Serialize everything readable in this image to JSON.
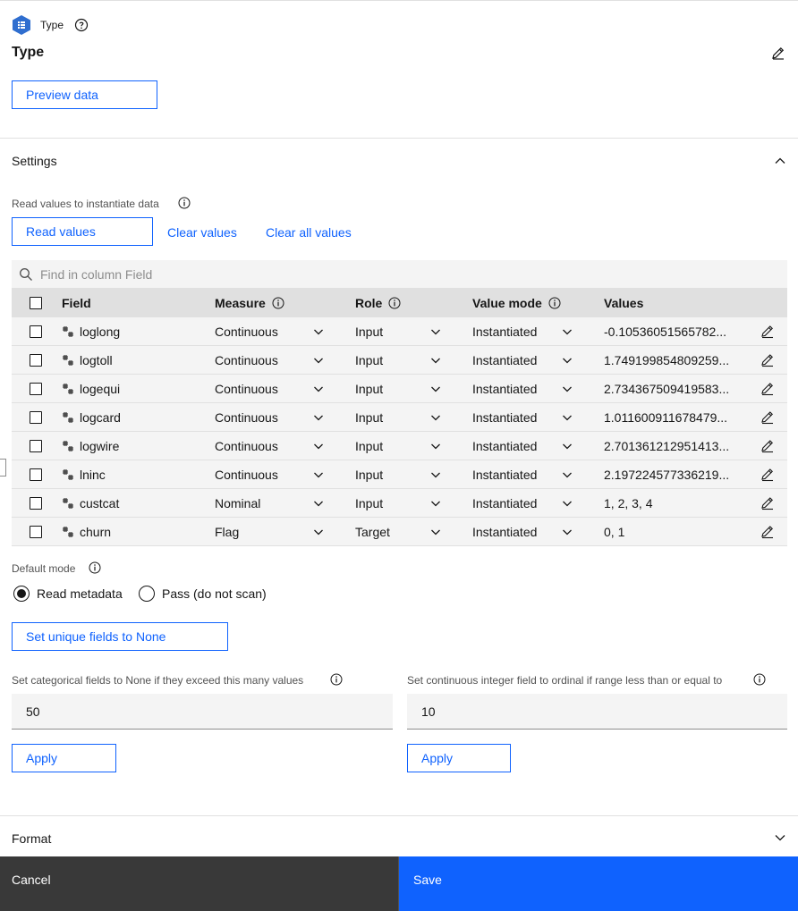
{
  "header": {
    "node_type_label": "Type",
    "title": "Type",
    "preview_button": "Preview data"
  },
  "settings": {
    "section_title": "Settings",
    "read_values_label": "Read values to instantiate data",
    "read_values_button": "Read values",
    "clear_values_link": "Clear values",
    "clear_all_values_link": "Clear all values",
    "search_placeholder": "Find in column Field",
    "columns": {
      "field": "Field",
      "measure": "Measure",
      "role": "Role",
      "value_mode": "Value mode",
      "values": "Values"
    },
    "rows": [
      {
        "field": "loglong",
        "measure": "Continuous",
        "role": "Input",
        "value_mode": "Instantiated",
        "values": "-0.10536051565782..."
      },
      {
        "field": "logtoll",
        "measure": "Continuous",
        "role": "Input",
        "value_mode": "Instantiated",
        "values": "1.749199854809259..."
      },
      {
        "field": "logequi",
        "measure": "Continuous",
        "role": "Input",
        "value_mode": "Instantiated",
        "values": "2.734367509419583..."
      },
      {
        "field": "logcard",
        "measure": "Continuous",
        "role": "Input",
        "value_mode": "Instantiated",
        "values": "1.011600911678479..."
      },
      {
        "field": "logwire",
        "measure": "Continuous",
        "role": "Input",
        "value_mode": "Instantiated",
        "values": "2.701361212951413..."
      },
      {
        "field": "lninc",
        "measure": "Continuous",
        "role": "Input",
        "value_mode": "Instantiated",
        "values": "2.197224577336219..."
      },
      {
        "field": "custcat",
        "measure": "Nominal",
        "role": "Input",
        "value_mode": "Instantiated",
        "values": "1, 2, 3, 4"
      },
      {
        "field": "churn",
        "measure": "Flag",
        "role": "Target",
        "value_mode": "Instantiated",
        "values": "0, 1"
      }
    ],
    "default_mode_label": "Default mode",
    "default_mode_options": [
      "Read metadata",
      "Pass (do not scan)"
    ],
    "default_mode_selected": "Read metadata",
    "unique_fields_button": "Set unique fields to None",
    "categorical_label": "Set categorical fields to None if they exceed this many values",
    "categorical_value": "50",
    "ordinal_label": "Set continuous integer field to ordinal if range less than or equal to",
    "ordinal_value": "10",
    "apply_label": "Apply"
  },
  "format": {
    "section_title": "Format"
  },
  "footer": {
    "cancel": "Cancel",
    "save": "Save"
  },
  "colors": {
    "accent": "#0f62fe",
    "node_icon": "#2f6ecf",
    "cancel_bg": "#393939"
  },
  "icons": [
    "node-type-icon",
    "help-icon",
    "edit-icon",
    "chevron-up-icon",
    "chevron-down-icon",
    "info-icon",
    "search-icon",
    "numeric-field-icon"
  ]
}
